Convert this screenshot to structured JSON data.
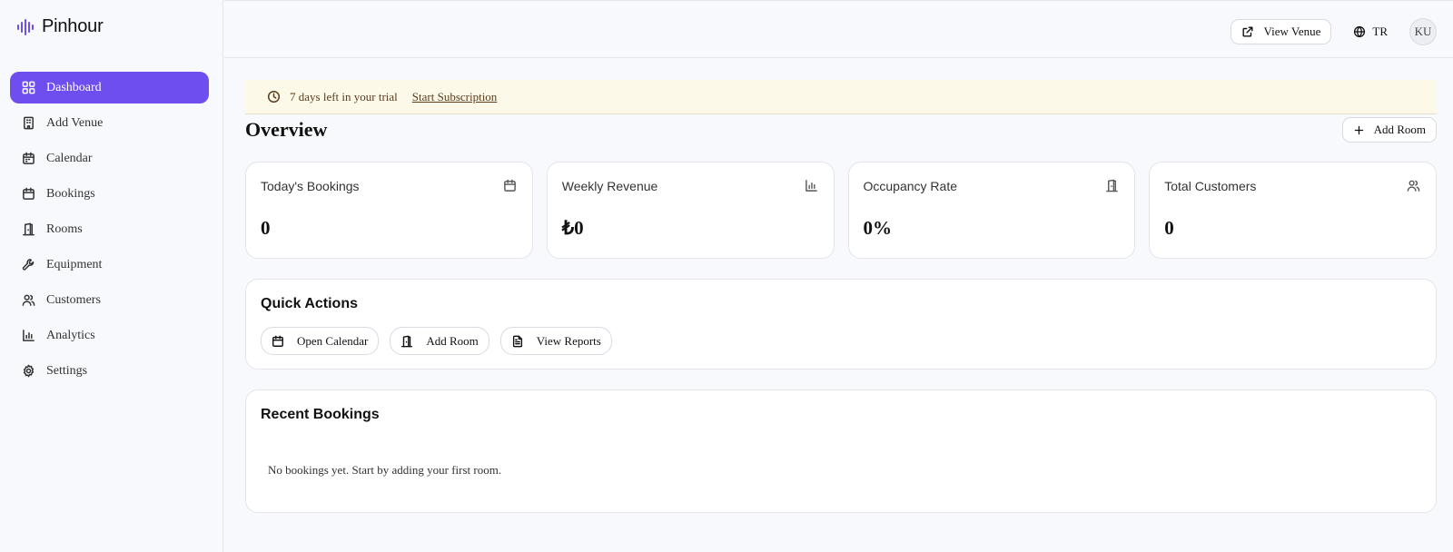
{
  "brand": {
    "name": "Pinhour",
    "accent": "#6f4ef0"
  },
  "sidebar": {
    "items": [
      {
        "label": "Dashboard",
        "icon": "dashboard-icon",
        "active": true
      },
      {
        "label": "Add Venue",
        "icon": "building-icon",
        "active": false
      },
      {
        "label": "Calendar",
        "icon": "calendar-icon",
        "active": false
      },
      {
        "label": "Bookings",
        "icon": "calendar-icon",
        "active": false
      },
      {
        "label": "Rooms",
        "icon": "door-icon",
        "active": false
      },
      {
        "label": "Equipment",
        "icon": "wrench-icon",
        "active": false
      },
      {
        "label": "Customers",
        "icon": "users-icon",
        "active": false
      },
      {
        "label": "Analytics",
        "icon": "bar-chart-icon",
        "active": false
      },
      {
        "label": "Settings",
        "icon": "gear-icon",
        "active": false
      }
    ]
  },
  "topbar": {
    "view_venue": "View Venue",
    "language": "TR",
    "avatar_initials": "KU"
  },
  "trial": {
    "message": "7 days left in your trial",
    "link": "Start Subscription"
  },
  "overview": {
    "title": "Overview",
    "add_room": "Add Room"
  },
  "stats": [
    {
      "title": "Today's Bookings",
      "value": "0",
      "icon": "calendar-icon"
    },
    {
      "title": "Weekly Revenue",
      "value": "₺0",
      "icon": "bar-chart-icon"
    },
    {
      "title": "Occupancy Rate",
      "value": "0%",
      "icon": "door-icon"
    },
    {
      "title": "Total Customers",
      "value": "0",
      "icon": "users-icon"
    }
  ],
  "quick_actions": {
    "title": "Quick Actions",
    "buttons": [
      {
        "label": "Open Calendar",
        "icon": "calendar-icon"
      },
      {
        "label": "Add Room",
        "icon": "door-icon"
      },
      {
        "label": "View Reports",
        "icon": "file-text-icon"
      }
    ]
  },
  "recent_bookings": {
    "title": "Recent Bookings",
    "empty": "No bookings yet. Start by adding your first room."
  }
}
